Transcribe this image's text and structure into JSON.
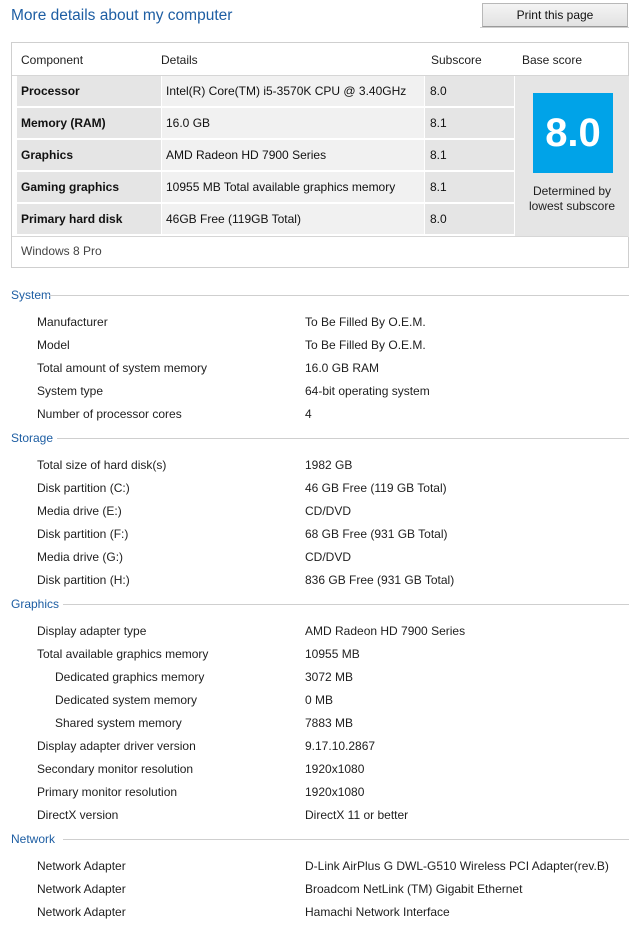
{
  "header": {
    "title": "More details about my computer",
    "print_label": "Print this page"
  },
  "score_table": {
    "columns": [
      "Component",
      "Details",
      "Subscore",
      "Base score"
    ],
    "rows": [
      {
        "component": "Processor",
        "details": "Intel(R) Core(TM) i5-3570K CPU @ 3.40GHz",
        "subscore": "8.0"
      },
      {
        "component": "Memory (RAM)",
        "details": "16.0 GB",
        "subscore": "8.1"
      },
      {
        "component": "Graphics",
        "details": "AMD Radeon HD 7900 Series",
        "subscore": "8.1"
      },
      {
        "component": "Gaming graphics",
        "details": "10955 MB Total available graphics memory",
        "subscore": "8.1"
      },
      {
        "component": "Primary hard disk",
        "details": "46GB Free (119GB Total)",
        "subscore": "8.0"
      }
    ],
    "base_score": "8.0",
    "base_caption_1": "Determined by",
    "base_caption_2": "lowest subscore",
    "os": "Windows 8 Pro",
    "tile_color": "#00a3e8"
  },
  "sections": [
    {
      "title": "System",
      "items": [
        {
          "label": "Manufacturer",
          "value": "To Be Filled By O.E.M."
        },
        {
          "label": "Model",
          "value": "To Be Filled By O.E.M."
        },
        {
          "label": "Total amount of system memory",
          "value": "16.0 GB RAM"
        },
        {
          "label": "System type",
          "value": "64-bit operating system"
        },
        {
          "label": "Number of processor cores",
          "value": "4"
        }
      ]
    },
    {
      "title": "Storage",
      "items": [
        {
          "label": "Total size of hard disk(s)",
          "value": "1982 GB"
        },
        {
          "label": "Disk partition (C:)",
          "value": "46 GB Free (119 GB Total)"
        },
        {
          "label": "Media drive (E:)",
          "value": "CD/DVD"
        },
        {
          "label": "Disk partition (F:)",
          "value": "68 GB Free (931 GB Total)"
        },
        {
          "label": "Media drive (G:)",
          "value": "CD/DVD"
        },
        {
          "label": "Disk partition (H:)",
          "value": "836 GB Free (931 GB Total)"
        }
      ]
    },
    {
      "title": "Graphics",
      "items": [
        {
          "label": "Display adapter type",
          "value": "AMD Radeon HD 7900 Series"
        },
        {
          "label": "Total available graphics memory",
          "value": "10955 MB"
        },
        {
          "label": "Dedicated graphics memory",
          "value": "3072 MB",
          "indent": true
        },
        {
          "label": "Dedicated system memory",
          "value": "0 MB",
          "indent": true
        },
        {
          "label": "Shared system memory",
          "value": "7883 MB",
          "indent": true
        },
        {
          "label": "Display adapter driver version",
          "value": "9.17.10.2867"
        },
        {
          "label": "Secondary monitor resolution",
          "value": "1920x1080"
        },
        {
          "label": "Primary monitor resolution",
          "value": "1920x1080"
        },
        {
          "label": "DirectX version",
          "value": "DirectX 11 or better"
        }
      ]
    },
    {
      "title": "Network",
      "items": [
        {
          "label": "Network Adapter",
          "value": "D-Link AirPlus G DWL-G510 Wireless PCI Adapter(rev.B)"
        },
        {
          "label": "Network Adapter",
          "value": "Broadcom NetLink (TM) Gigabit Ethernet"
        },
        {
          "label": "Network Adapter",
          "value": "Hamachi Network Interface"
        }
      ]
    }
  ]
}
